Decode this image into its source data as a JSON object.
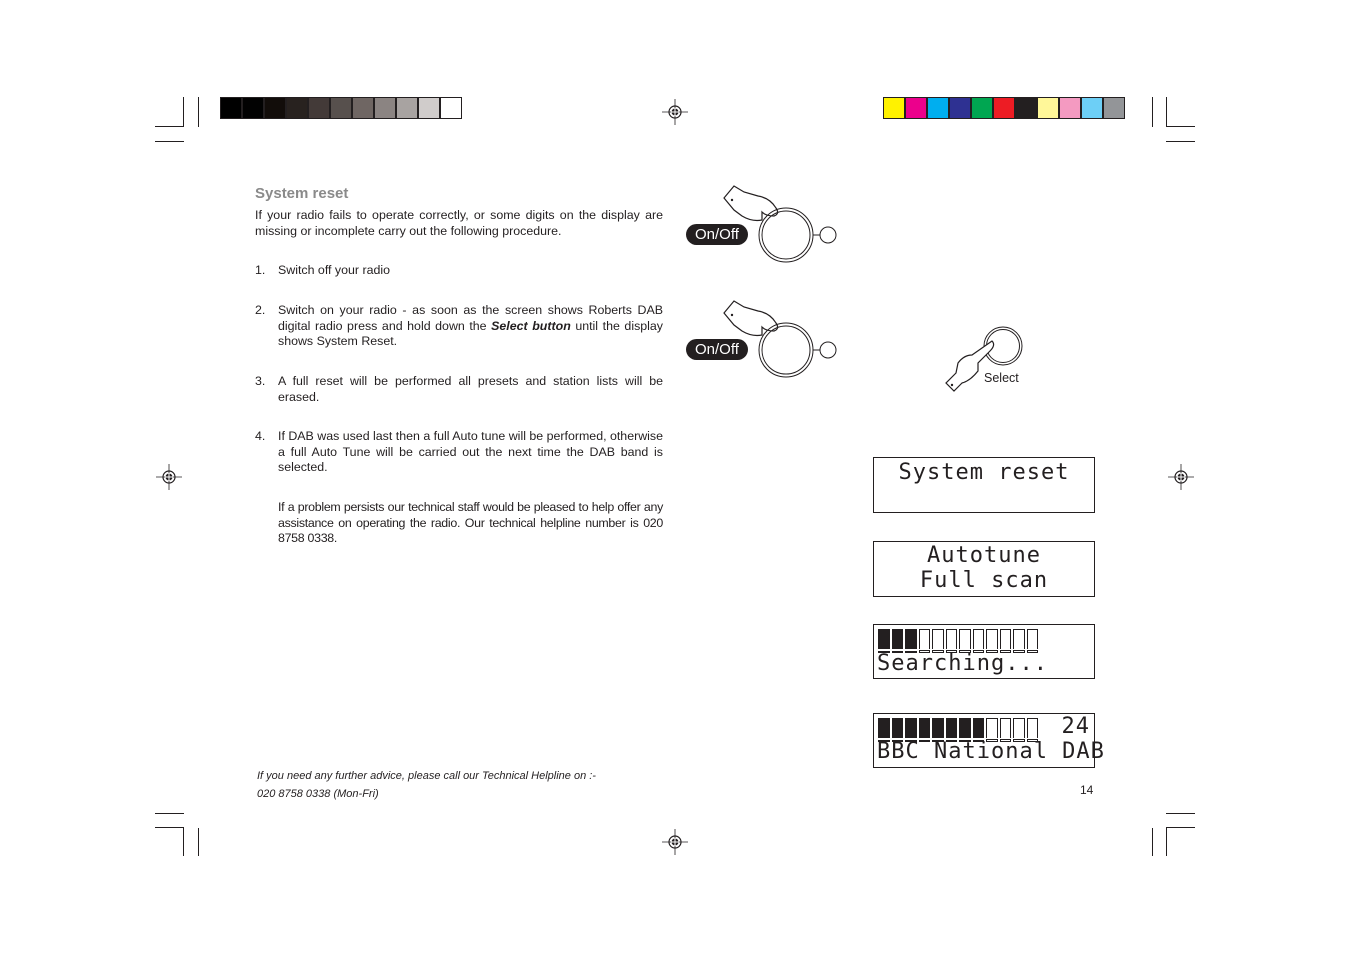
{
  "color_bars": {
    "grayscale": [
      "#000000",
      "#020202",
      "#120d0a",
      "#28221f",
      "#433a38",
      "#57504d",
      "#6f6663",
      "#8b8482",
      "#a8a3a1",
      "#d0cccb",
      "#ffffff"
    ],
    "process": [
      "#fff200",
      "#ec008c",
      "#00aeef",
      "#2e3192",
      "#00a651",
      "#ed1c24",
      "#231f20",
      "#fff799",
      "#f49ac1",
      "#6dcff6",
      "#939598"
    ]
  },
  "heading": "System reset",
  "intro": "If your radio fails to operate correctly, or some digits on the display are missing or incomplete carry out the following procedure.",
  "steps": [
    {
      "num": "1.",
      "text": "Switch off your radio"
    },
    {
      "num": "2.",
      "text_before": "Switch on your radio - as soon as the screen shows Roberts DAB digital radio press and hold down the ",
      "emphasis": "Select button",
      "text_after": " until the display shows System Reset."
    },
    {
      "num": "3.",
      "text": "A full reset will be performed all presets and station lists will be erased."
    },
    {
      "num": "4.",
      "text": " If DAB was used last then a full Auto tune will be performed, otherwise a full Auto Tune will be carried out the next time the DAB band is selected."
    }
  ],
  "note": "If a problem persists our technical staff would be pleased to help offer any assistance on operating the radio. Our technical helpline number is 020 8758 0338.",
  "illustrations": {
    "onoff_label": "On/Off",
    "select_label": "Select"
  },
  "displays": [
    {
      "line1": "System reset",
      "line2": ""
    },
    {
      "line1": "Autotune",
      "line2": "Full scan"
    },
    {
      "progress_filled": 3,
      "progress_total": 12,
      "count": "",
      "line2": "Searching..."
    },
    {
      "progress_filled": 8,
      "progress_total": 12,
      "count": "24",
      "line2": "BBC National DAB"
    }
  ],
  "footer": {
    "line1": "If you need any further advice, please call our Technical Helpline on :-",
    "line2": "020 8758 0338 (Mon-Fri)"
  },
  "page_number": "14"
}
